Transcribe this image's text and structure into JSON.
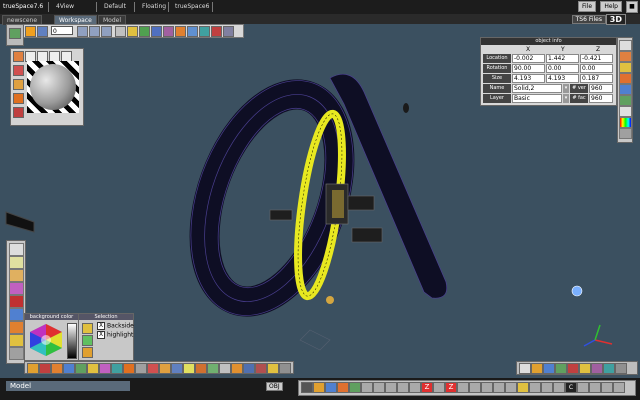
{
  "app": {
    "title": "trueSpace7.6"
  },
  "menu": {
    "items": [
      "4View",
      "Default",
      "Floating",
      "trueSpace6"
    ],
    "file": "File",
    "help": "Help"
  },
  "tabs": [
    "newscene",
    "Workspace",
    "Model"
  ],
  "header_right": {
    "files_label": "TS6 Files",
    "mode_label": "3D"
  },
  "toolbar": {
    "frame_value": "0"
  },
  "object_info": {
    "title": "object info",
    "columns": [
      "X",
      "Y",
      "Z"
    ],
    "rows": [
      {
        "label": "Location",
        "values": [
          "-0.002",
          "1.442",
          "-0.421"
        ]
      },
      {
        "label": "Rotation",
        "values": [
          "90.00",
          "0.00",
          "0.00"
        ]
      },
      {
        "label": "Size",
        "values": [
          "4.193",
          "4.193",
          "0.187"
        ]
      }
    ],
    "name_label": "Name",
    "name_value": "Solid,2",
    "layer_label": "Layer",
    "layer_value": "Basic",
    "vert_label": "# ver",
    "vert_value": "960",
    "face_label": "# fac",
    "face_value": "960"
  },
  "bgcolor_panel": {
    "title": "background color"
  },
  "selection_panel": {
    "title": "Selection",
    "backside_label": "Backside",
    "highlight_label": "highlight"
  },
  "status": {
    "mode_label": "Model",
    "obj_label": "OBJ"
  },
  "colors": {
    "viewport": "#3b5060",
    "wire": "#14142a",
    "selected": "#e8e820",
    "accent": "#5a6a7a"
  }
}
